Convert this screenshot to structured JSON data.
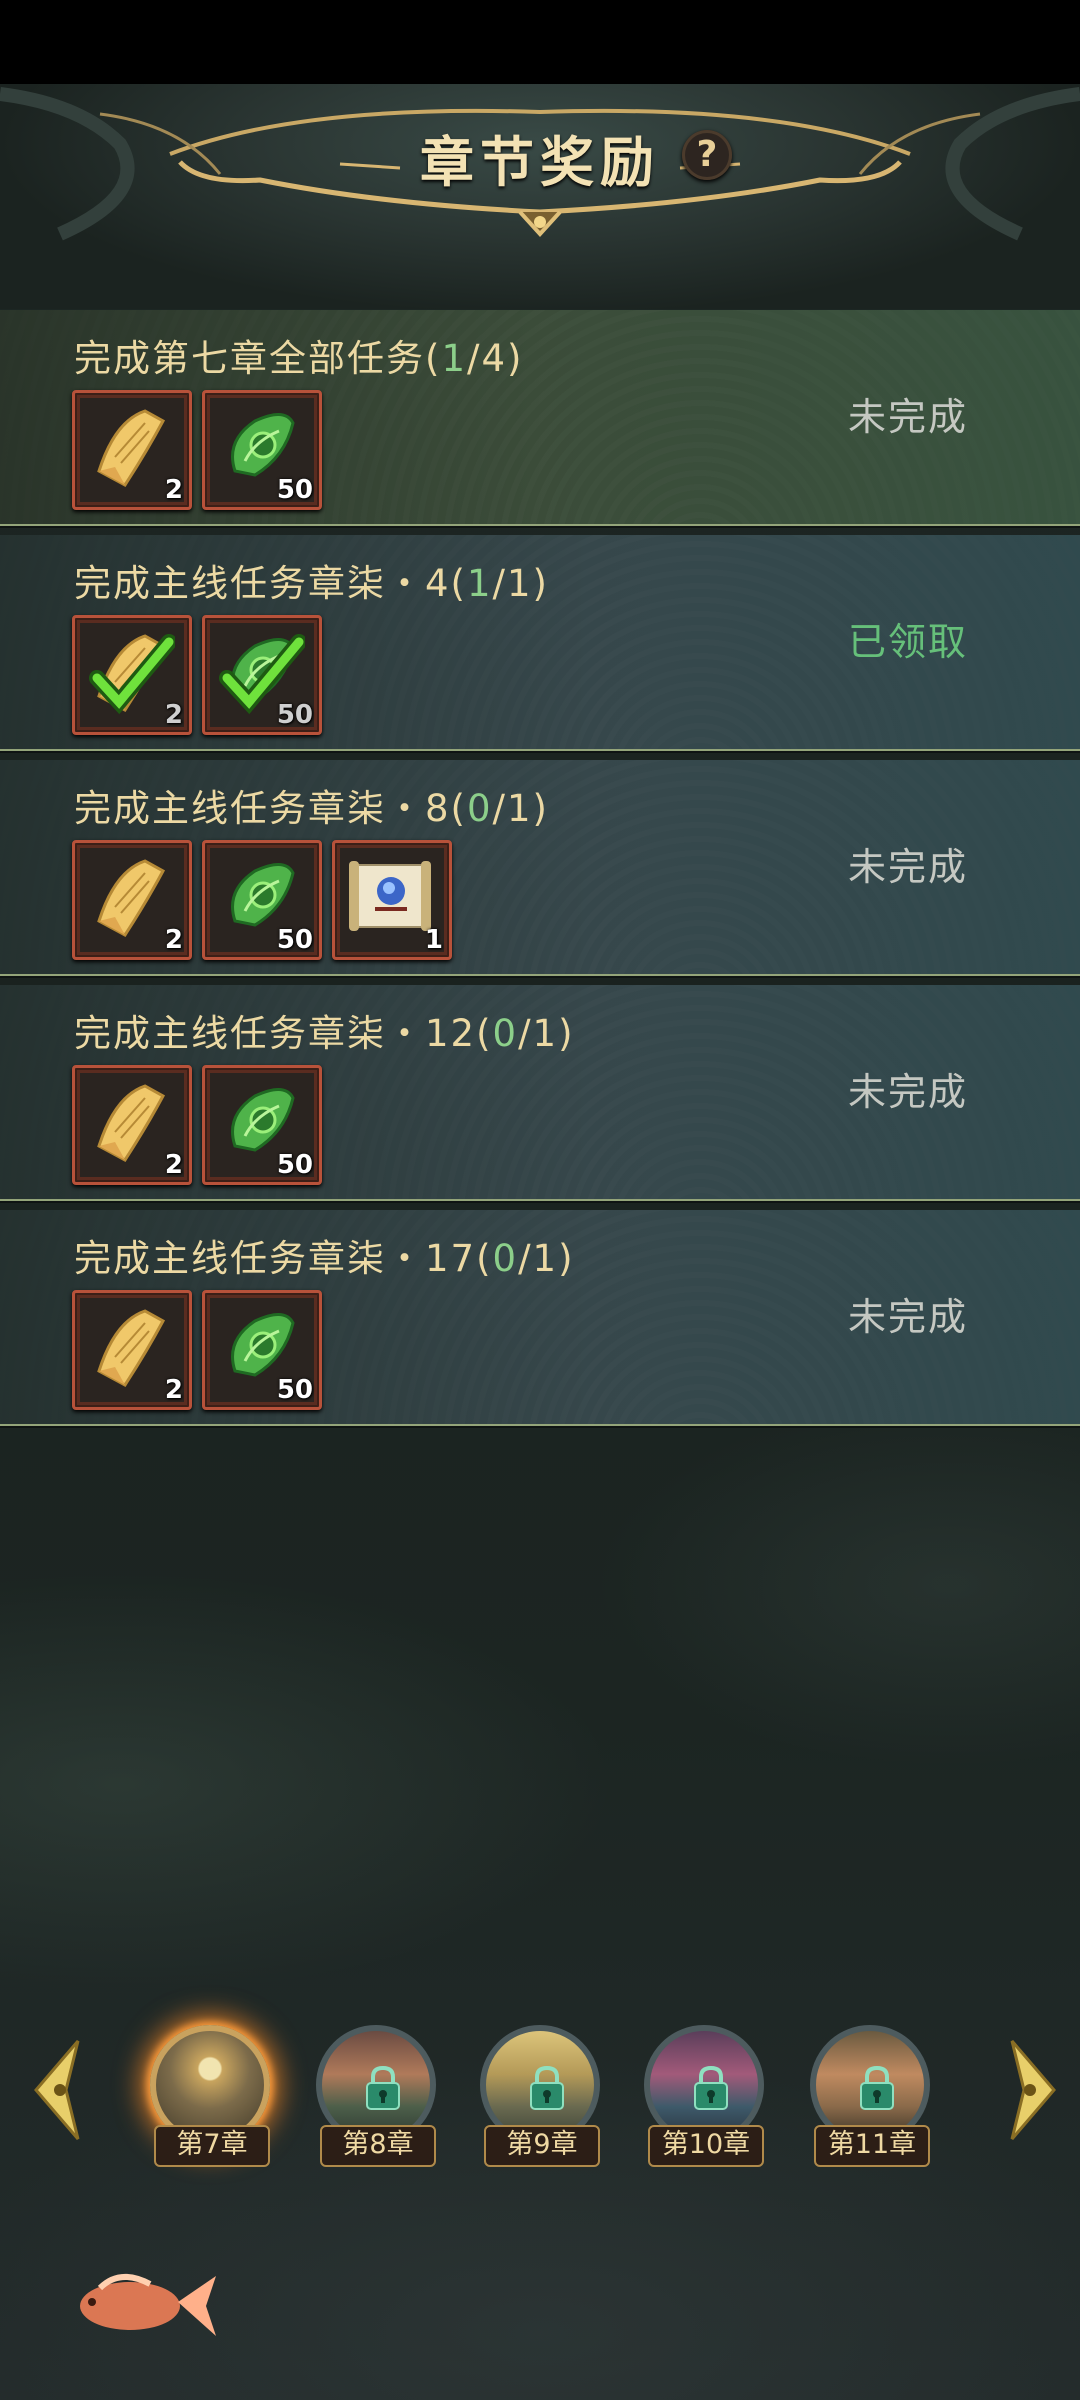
{
  "header": {
    "title": "章节奖励",
    "help_label": "?"
  },
  "tasks": [
    {
      "title": "完成第七章全部任务(",
      "progress": "1",
      "total": "/4)",
      "status": "未完成",
      "claimed": false,
      "items": [
        {
          "icon": "scroll-ticket-icon",
          "count": "2"
        },
        {
          "icon": "jade-pendant-icon",
          "count": "50"
        }
      ]
    },
    {
      "title": "完成主线任务章柒・4(",
      "progress": "1",
      "total": "/1)",
      "status": "已领取",
      "claimed": true,
      "items": [
        {
          "icon": "scroll-ticket-icon",
          "count": "2"
        },
        {
          "icon": "jade-pendant-icon",
          "count": "50"
        }
      ]
    },
    {
      "title": "完成主线任务章柒・8(",
      "progress": "0",
      "total": "/1)",
      "status": "未完成",
      "claimed": false,
      "items": [
        {
          "icon": "scroll-ticket-icon",
          "count": "2"
        },
        {
          "icon": "jade-pendant-icon",
          "count": "50"
        },
        {
          "icon": "map-scroll-icon",
          "count": "1"
        }
      ]
    },
    {
      "title": "完成主线任务章柒・12(",
      "progress": "0",
      "total": "/1)",
      "status": "未完成",
      "claimed": false,
      "items": [
        {
          "icon": "scroll-ticket-icon",
          "count": "2"
        },
        {
          "icon": "jade-pendant-icon",
          "count": "50"
        }
      ]
    },
    {
      "title": "完成主线任务章柒・17(",
      "progress": "0",
      "total": "/1)",
      "status": "未完成",
      "claimed": false,
      "items": [
        {
          "icon": "scroll-ticket-icon",
          "count": "2"
        },
        {
          "icon": "jade-pendant-icon",
          "count": "50"
        }
      ]
    }
  ],
  "chapters": [
    {
      "label": "第7章",
      "active": true,
      "locked": false
    },
    {
      "label": "第8章",
      "active": false,
      "locked": true
    },
    {
      "label": "第9章",
      "active": false,
      "locked": true
    },
    {
      "label": "第10章",
      "active": false,
      "locked": true
    },
    {
      "label": "第11章",
      "active": false,
      "locked": true
    }
  ],
  "colors": {
    "title": "#f3e2b4",
    "task_title": "#ecd9a4",
    "progress": "#8ccf8a",
    "claimed": "#66c07a",
    "incomplete": "#c5c8c2",
    "item_border": "#b8523a"
  }
}
